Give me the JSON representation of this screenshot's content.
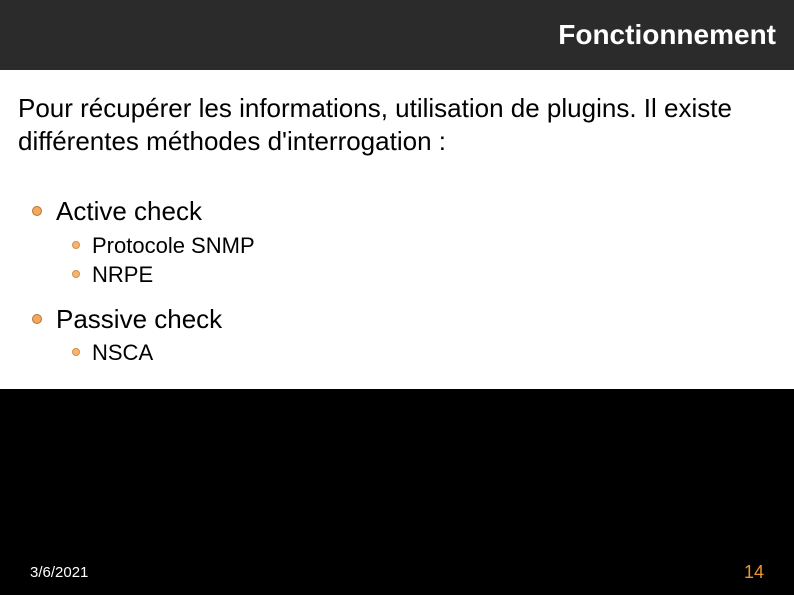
{
  "header": {
    "title": "Fonctionnement"
  },
  "intro": "Pour récupérer les informations, utilisation de plugins. Il existe différentes méthodes d'interrogation  :",
  "items": [
    {
      "label": "Active check",
      "sub": [
        {
          "label": "Protocole SNMP"
        },
        {
          "label": "NRPE"
        }
      ]
    },
    {
      "label": "Passive check",
      "sub": [
        {
          "label": "NSCA"
        }
      ]
    }
  ],
  "footer": {
    "date": "3/6/2021",
    "page": "14"
  }
}
